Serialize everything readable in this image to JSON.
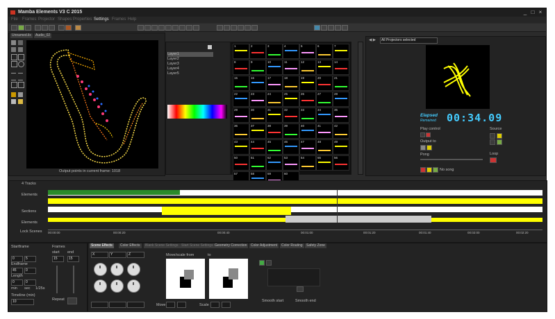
{
  "window": {
    "title": "Mamba Elements V3 C 2015",
    "min": "_",
    "max": "□",
    "close": "×"
  },
  "menu": [
    "File",
    "Frames",
    "Projector",
    "Shapes",
    "Properties",
    "Settings",
    "Frames",
    "Help"
  ],
  "menu_active_index": 5,
  "editor": {
    "tabs": [
      "Unnamed.ilx",
      "Audio_02"
    ],
    "output_points": "Output points in current frame: 1018"
  },
  "layers": [
    "Layer1",
    "Layer2",
    "Layer3",
    "Layer4",
    "Layer5"
  ],
  "grid_numbers": [
    "1",
    "2",
    "3",
    "4",
    "5",
    "6",
    "7",
    "8",
    "9",
    "10",
    "11",
    "12",
    "13",
    "14",
    "15",
    "16",
    "17",
    "18",
    "19",
    "20",
    "21",
    "22",
    "23",
    "24",
    "25",
    "26",
    "27",
    "28",
    "29",
    "30",
    "31",
    "32",
    "33",
    "34",
    "35",
    "36",
    "37",
    "38",
    "39",
    "40",
    "41",
    "42",
    "43",
    "44",
    "45",
    "46",
    "47",
    "48",
    "49",
    "50",
    "51",
    "52",
    "53",
    "54",
    "55",
    "56",
    "57",
    "58",
    "59",
    "60"
  ],
  "projector": {
    "selector": "All Projectors selected",
    "elapsed_label": "Elapsed",
    "elapsed_sub": "Remained",
    "time": "00:34.09",
    "play_control": "Play control",
    "output_to": "Output to",
    "pong": "Pong",
    "source": "Source",
    "loop": "Loop",
    "no_song": "No song"
  },
  "timeline": {
    "tracks_header": "4 Tracks",
    "tracks": [
      "Elements",
      "",
      "Sections",
      "Elements"
    ],
    "lock_scenes": "Lock Scenes",
    "times": [
      "00:00:00",
      "00:00:20",
      "00:00:40",
      "00:01:00",
      "00:01:20",
      "00:01:40",
      "00:02:00",
      "00:02:20"
    ]
  },
  "left_panel": {
    "start_frame": "Startframe",
    "frames": "Frames",
    "start": "start",
    "end": "end",
    "start_val": "15",
    "end_val": "15",
    "end_frame": "Endframe",
    "length": "Length",
    "min": "min",
    "sec": "sec",
    "fps": "1/25s",
    "timeline_min": "Timeline (min)",
    "timeline_val": "10",
    "repeat": "Repeat",
    "spin_vals": [
      "0",
      "5",
      "45",
      "0",
      "0",
      "0"
    ]
  },
  "effect_tabs": [
    "Scene Effects",
    "Color Effects",
    "Blank Scene Settings",
    "Start Scene Settings",
    "Geometry Correction",
    "Color Adjustment",
    "Color Routing",
    "Safety Zone"
  ],
  "scene_effects": {
    "axes": [
      "X",
      "Y",
      "Z"
    ],
    "move_scale_from": "Move/scale from",
    "to": "to",
    "move": "Move",
    "scale": "Scale",
    "smooth_start": "Smooth start",
    "smooth_end": "Smooth end"
  },
  "colors": {
    "accent_yellow": "#ffff00",
    "clock": "#44ccff",
    "window_bg": "#2b2b2b"
  }
}
